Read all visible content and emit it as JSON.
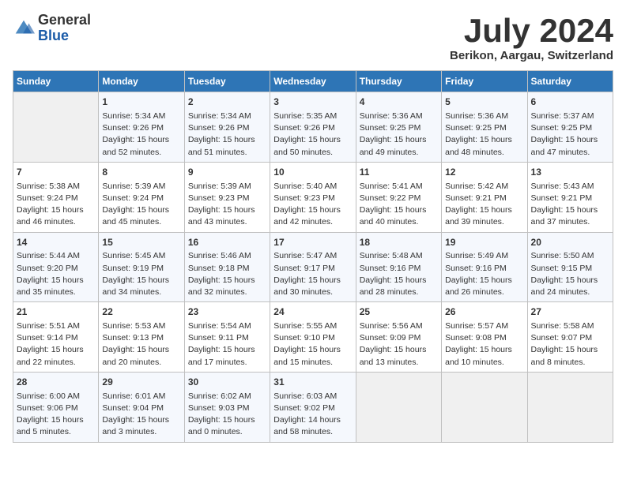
{
  "header": {
    "logo_general": "General",
    "logo_blue": "Blue",
    "month_title": "July 2024",
    "location": "Berikon, Aargau, Switzerland"
  },
  "columns": [
    "Sunday",
    "Monday",
    "Tuesday",
    "Wednesday",
    "Thursday",
    "Friday",
    "Saturday"
  ],
  "weeks": [
    {
      "days": [
        {
          "num": "",
          "empty": true
        },
        {
          "num": "1",
          "sunrise": "Sunrise: 5:34 AM",
          "sunset": "Sunset: 9:26 PM",
          "daylight": "Daylight: 15 hours and 52 minutes."
        },
        {
          "num": "2",
          "sunrise": "Sunrise: 5:34 AM",
          "sunset": "Sunset: 9:26 PM",
          "daylight": "Daylight: 15 hours and 51 minutes."
        },
        {
          "num": "3",
          "sunrise": "Sunrise: 5:35 AM",
          "sunset": "Sunset: 9:26 PM",
          "daylight": "Daylight: 15 hours and 50 minutes."
        },
        {
          "num": "4",
          "sunrise": "Sunrise: 5:36 AM",
          "sunset": "Sunset: 9:25 PM",
          "daylight": "Daylight: 15 hours and 49 minutes."
        },
        {
          "num": "5",
          "sunrise": "Sunrise: 5:36 AM",
          "sunset": "Sunset: 9:25 PM",
          "daylight": "Daylight: 15 hours and 48 minutes."
        },
        {
          "num": "6",
          "sunrise": "Sunrise: 5:37 AM",
          "sunset": "Sunset: 9:25 PM",
          "daylight": "Daylight: 15 hours and 47 minutes."
        }
      ]
    },
    {
      "days": [
        {
          "num": "7",
          "sunrise": "Sunrise: 5:38 AM",
          "sunset": "Sunset: 9:24 PM",
          "daylight": "Daylight: 15 hours and 46 minutes."
        },
        {
          "num": "8",
          "sunrise": "Sunrise: 5:39 AM",
          "sunset": "Sunset: 9:24 PM",
          "daylight": "Daylight: 15 hours and 45 minutes."
        },
        {
          "num": "9",
          "sunrise": "Sunrise: 5:39 AM",
          "sunset": "Sunset: 9:23 PM",
          "daylight": "Daylight: 15 hours and 43 minutes."
        },
        {
          "num": "10",
          "sunrise": "Sunrise: 5:40 AM",
          "sunset": "Sunset: 9:23 PM",
          "daylight": "Daylight: 15 hours and 42 minutes."
        },
        {
          "num": "11",
          "sunrise": "Sunrise: 5:41 AM",
          "sunset": "Sunset: 9:22 PM",
          "daylight": "Daylight: 15 hours and 40 minutes."
        },
        {
          "num": "12",
          "sunrise": "Sunrise: 5:42 AM",
          "sunset": "Sunset: 9:21 PM",
          "daylight": "Daylight: 15 hours and 39 minutes."
        },
        {
          "num": "13",
          "sunrise": "Sunrise: 5:43 AM",
          "sunset": "Sunset: 9:21 PM",
          "daylight": "Daylight: 15 hours and 37 minutes."
        }
      ]
    },
    {
      "days": [
        {
          "num": "14",
          "sunrise": "Sunrise: 5:44 AM",
          "sunset": "Sunset: 9:20 PM",
          "daylight": "Daylight: 15 hours and 35 minutes."
        },
        {
          "num": "15",
          "sunrise": "Sunrise: 5:45 AM",
          "sunset": "Sunset: 9:19 PM",
          "daylight": "Daylight: 15 hours and 34 minutes."
        },
        {
          "num": "16",
          "sunrise": "Sunrise: 5:46 AM",
          "sunset": "Sunset: 9:18 PM",
          "daylight": "Daylight: 15 hours and 32 minutes."
        },
        {
          "num": "17",
          "sunrise": "Sunrise: 5:47 AM",
          "sunset": "Sunset: 9:17 PM",
          "daylight": "Daylight: 15 hours and 30 minutes."
        },
        {
          "num": "18",
          "sunrise": "Sunrise: 5:48 AM",
          "sunset": "Sunset: 9:16 PM",
          "daylight": "Daylight: 15 hours and 28 minutes."
        },
        {
          "num": "19",
          "sunrise": "Sunrise: 5:49 AM",
          "sunset": "Sunset: 9:16 PM",
          "daylight": "Daylight: 15 hours and 26 minutes."
        },
        {
          "num": "20",
          "sunrise": "Sunrise: 5:50 AM",
          "sunset": "Sunset: 9:15 PM",
          "daylight": "Daylight: 15 hours and 24 minutes."
        }
      ]
    },
    {
      "days": [
        {
          "num": "21",
          "sunrise": "Sunrise: 5:51 AM",
          "sunset": "Sunset: 9:14 PM",
          "daylight": "Daylight: 15 hours and 22 minutes."
        },
        {
          "num": "22",
          "sunrise": "Sunrise: 5:53 AM",
          "sunset": "Sunset: 9:13 PM",
          "daylight": "Daylight: 15 hours and 20 minutes."
        },
        {
          "num": "23",
          "sunrise": "Sunrise: 5:54 AM",
          "sunset": "Sunset: 9:11 PM",
          "daylight": "Daylight: 15 hours and 17 minutes."
        },
        {
          "num": "24",
          "sunrise": "Sunrise: 5:55 AM",
          "sunset": "Sunset: 9:10 PM",
          "daylight": "Daylight: 15 hours and 15 minutes."
        },
        {
          "num": "25",
          "sunrise": "Sunrise: 5:56 AM",
          "sunset": "Sunset: 9:09 PM",
          "daylight": "Daylight: 15 hours and 13 minutes."
        },
        {
          "num": "26",
          "sunrise": "Sunrise: 5:57 AM",
          "sunset": "Sunset: 9:08 PM",
          "daylight": "Daylight: 15 hours and 10 minutes."
        },
        {
          "num": "27",
          "sunrise": "Sunrise: 5:58 AM",
          "sunset": "Sunset: 9:07 PM",
          "daylight": "Daylight: 15 hours and 8 minutes."
        }
      ]
    },
    {
      "days": [
        {
          "num": "28",
          "sunrise": "Sunrise: 6:00 AM",
          "sunset": "Sunset: 9:06 PM",
          "daylight": "Daylight: 15 hours and 5 minutes."
        },
        {
          "num": "29",
          "sunrise": "Sunrise: 6:01 AM",
          "sunset": "Sunset: 9:04 PM",
          "daylight": "Daylight: 15 hours and 3 minutes."
        },
        {
          "num": "30",
          "sunrise": "Sunrise: 6:02 AM",
          "sunset": "Sunset: 9:03 PM",
          "daylight": "Daylight: 15 hours and 0 minutes."
        },
        {
          "num": "31",
          "sunrise": "Sunrise: 6:03 AM",
          "sunset": "Sunset: 9:02 PM",
          "daylight": "Daylight: 14 hours and 58 minutes."
        },
        {
          "num": "",
          "empty": true
        },
        {
          "num": "",
          "empty": true
        },
        {
          "num": "",
          "empty": true
        }
      ]
    }
  ]
}
